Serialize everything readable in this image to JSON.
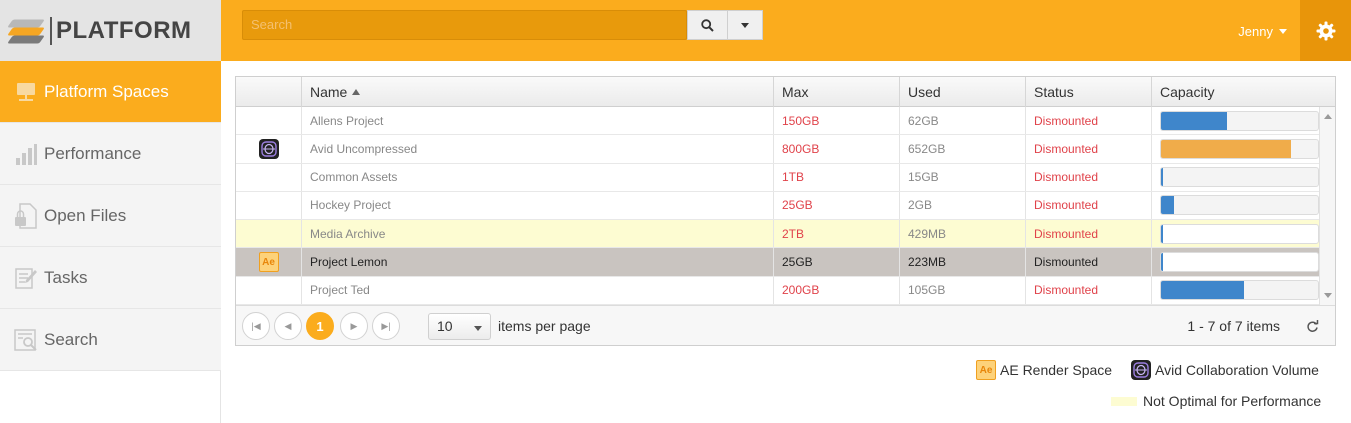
{
  "brand": {
    "name": "PLATFORM"
  },
  "nav": [
    {
      "label": "Platform Spaces",
      "icon": "hdd-network-icon",
      "active": true
    },
    {
      "label": "Performance",
      "icon": "bar-chart-icon"
    },
    {
      "label": "Open Files",
      "icon": "lock-file-icon"
    },
    {
      "label": "Tasks",
      "icon": "edit-list-icon"
    },
    {
      "label": "Search",
      "icon": "search-list-icon"
    }
  ],
  "header": {
    "search_placeholder": "Search",
    "user": "Jenny",
    "colors": {
      "accent": "#fbac1d",
      "accent_dark": "#e8950a"
    }
  },
  "grid": {
    "columns": [
      "Name",
      "Max",
      "Used",
      "Status",
      "Capacity"
    ],
    "rows": [
      {
        "icon": "",
        "name": "Allens Project",
        "max": "150GB",
        "used": "62GB",
        "status": "Dismounted",
        "capacity": 0.42,
        "bar": "#3f86cb",
        "state": ""
      },
      {
        "icon": "avid",
        "name": "Avid Uncompressed",
        "max": "800GB",
        "used": "652GB",
        "status": "Dismounted",
        "capacity": 0.83,
        "bar": "#f0ac4a",
        "state": ""
      },
      {
        "icon": "",
        "name": "Common Assets",
        "max": "1TB",
        "used": "15GB",
        "status": "Dismounted",
        "capacity": 0.015,
        "bar": "#3f86cb",
        "state": ""
      },
      {
        "icon": "",
        "name": "Hockey Project",
        "max": "25GB",
        "used": "2GB",
        "status": "Dismounted",
        "capacity": 0.08,
        "bar": "#3f86cb",
        "state": ""
      },
      {
        "icon": "",
        "name": "Media Archive",
        "max": "2TB",
        "used": "429MB",
        "status": "Dismounted",
        "capacity": 0.0,
        "bar": "#3f86cb",
        "state": "warn"
      },
      {
        "icon": "ae",
        "name": "Project Lemon",
        "max": "25GB",
        "used": "223MB",
        "status": "Dismounted",
        "capacity": 0.01,
        "bar": "#3f86cb",
        "state": "selected"
      },
      {
        "icon": "",
        "name": "Project Ted",
        "max": "200GB",
        "used": "105GB",
        "status": "Dismounted",
        "capacity": 0.53,
        "bar": "#3f86cb",
        "state": ""
      }
    ]
  },
  "pager": {
    "current_page": "1",
    "page_size": "10",
    "items_per_page_label": "items per page",
    "info": "1 - 7 of 7 items"
  },
  "legend": {
    "ae_label": "AE Render Space",
    "ae_icon_text": "Ae",
    "avid_label": "Avid Collaboration Volume",
    "not_optimal_label": "Not Optimal for Performance"
  }
}
